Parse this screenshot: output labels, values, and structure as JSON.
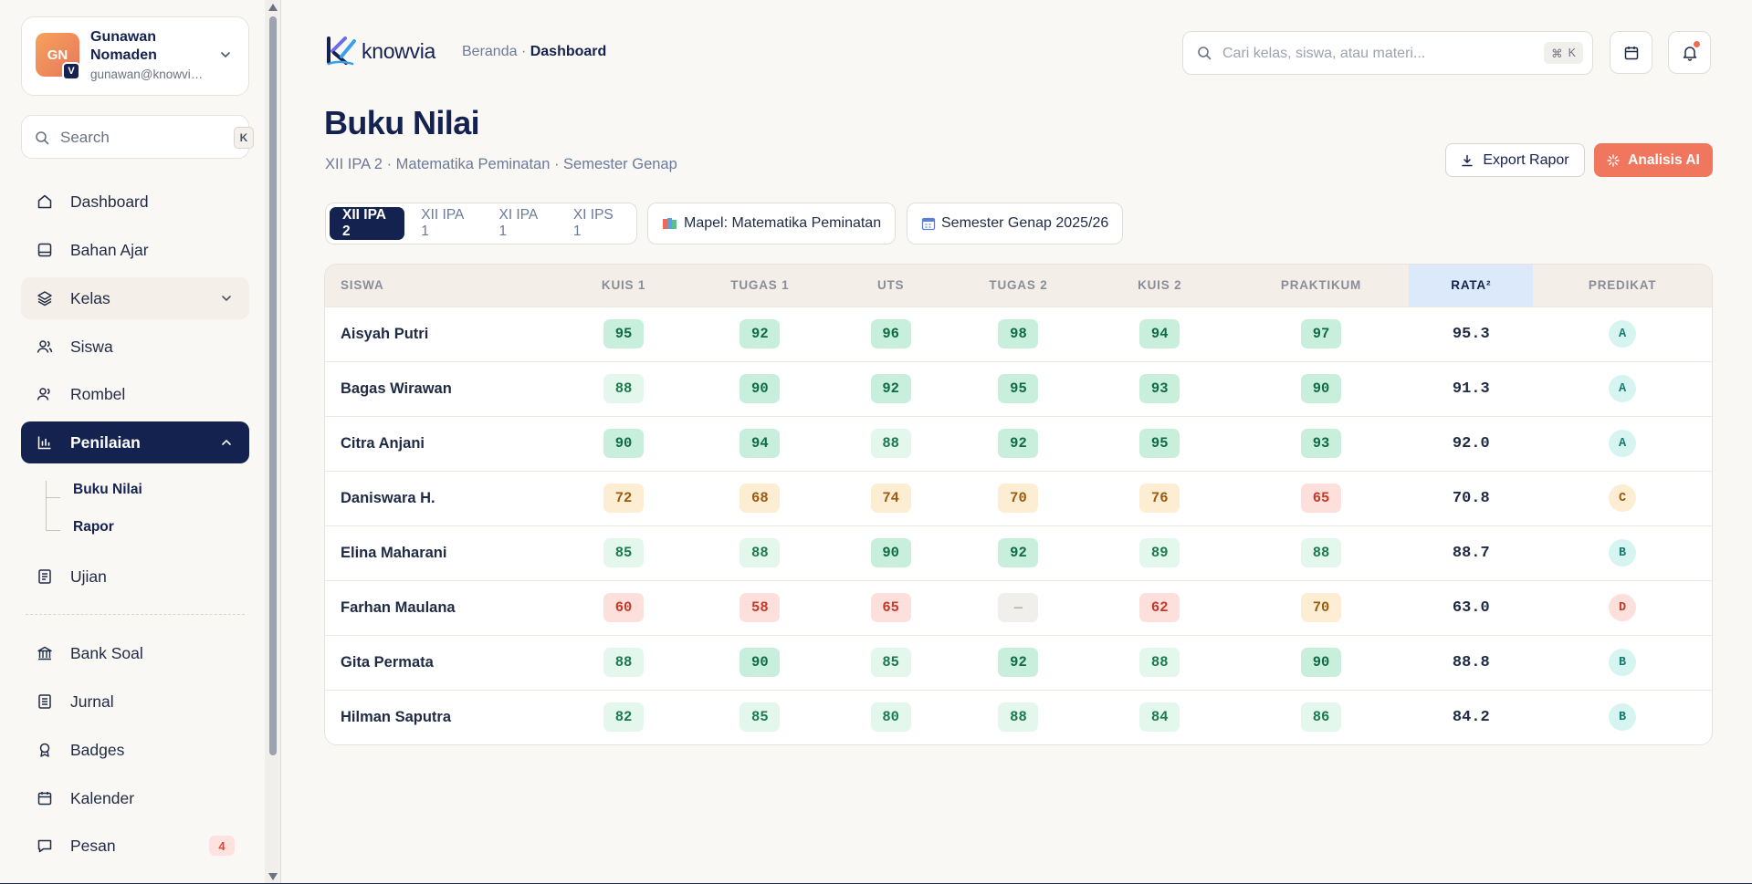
{
  "user": {
    "initials": "GN",
    "badge": "V",
    "name": "Gunawan Nomaden",
    "email": "gunawan@knowvia.id"
  },
  "sidebar": {
    "search_placeholder": "Search",
    "search_kbd": "K",
    "items": [
      {
        "label": "Dashboard",
        "icon": "home-icon"
      },
      {
        "label": "Bahan Ajar",
        "icon": "book-icon"
      },
      {
        "label": "Kelas",
        "icon": "layers-icon"
      },
      {
        "label": "Siswa",
        "icon": "users-icon"
      },
      {
        "label": "Rombel",
        "icon": "group-icon"
      },
      {
        "label": "Penilaian",
        "icon": "chart-icon"
      },
      {
        "label": "Ujian",
        "icon": "document-icon"
      },
      {
        "label": "Bank Soal",
        "icon": "bank-icon"
      },
      {
        "label": "Jurnal",
        "icon": "journal-icon"
      },
      {
        "label": "Badges",
        "icon": "award-icon"
      },
      {
        "label": "Kalender",
        "icon": "calendar-icon"
      },
      {
        "label": "Pesan",
        "icon": "message-icon",
        "count": "4"
      }
    ],
    "sub_items": [
      "Buku Nilai",
      "Rapor"
    ]
  },
  "topbar": {
    "logo_text": "knowvia",
    "breadcrumb_parent": "Beranda",
    "breadcrumb_sep": " · ",
    "breadcrumb_current": "Dashboard",
    "search_placeholder": "Cari kelas, siswa, atau materi...",
    "search_kbd_cmd": "⌘",
    "search_kbd_key": "K"
  },
  "header": {
    "title": "Buku Nilai",
    "subtitle": "XII IPA 2 · Matematika Peminatan · Semester Genap",
    "export_label": "Export Rapor",
    "ai_label": "Analisis AI"
  },
  "filters": {
    "classes": [
      "XII IPA 2",
      "XII IPA 1",
      "XI IPA 1",
      "XI IPS 1"
    ],
    "active_class": "XII IPA 2",
    "mapel": "Mapel: Matematika Peminatan",
    "semester": "Semester Genap 2025/26"
  },
  "table": {
    "columns": [
      "SISWA",
      "KUIS 1",
      "TUGAS 1",
      "UTS",
      "TUGAS 2",
      "KUIS 2",
      "PRAKTIKUM",
      "RATA²",
      "PREDIKAT"
    ],
    "rows": [
      {
        "name": "Aisyah Putri",
        "scores": [
          "95",
          "92",
          "96",
          "98",
          "94",
          "97"
        ],
        "avg": "95.3",
        "grade": "A"
      },
      {
        "name": "Bagas Wirawan",
        "scores": [
          "88",
          "90",
          "92",
          "95",
          "93",
          "90"
        ],
        "avg": "91.3",
        "grade": "A"
      },
      {
        "name": "Citra Anjani",
        "scores": [
          "90",
          "94",
          "88",
          "92",
          "95",
          "93"
        ],
        "avg": "92.0",
        "grade": "A"
      },
      {
        "name": "Daniswara H.",
        "scores": [
          "72",
          "68",
          "74",
          "70",
          "76",
          "65"
        ],
        "avg": "70.8",
        "grade": "C"
      },
      {
        "name": "Elina Maharani",
        "scores": [
          "85",
          "88",
          "90",
          "92",
          "89",
          "88"
        ],
        "avg": "88.7",
        "grade": "B"
      },
      {
        "name": "Farhan Maulana",
        "scores": [
          "60",
          "58",
          "65",
          "—",
          "62",
          "70"
        ],
        "avg": "63.0",
        "grade": "D"
      },
      {
        "name": "Gita Permata",
        "scores": [
          "88",
          "90",
          "85",
          "92",
          "88",
          "90"
        ],
        "avg": "88.8",
        "grade": "B"
      },
      {
        "name": "Hilman Saputra",
        "scores": [
          "82",
          "85",
          "80",
          "88",
          "84",
          "86"
        ],
        "avg": "84.2",
        "grade": "B"
      }
    ]
  },
  "colors": {
    "primary": "#14224f",
    "accent": "#f0775d",
    "background": "#faf8f5"
  }
}
